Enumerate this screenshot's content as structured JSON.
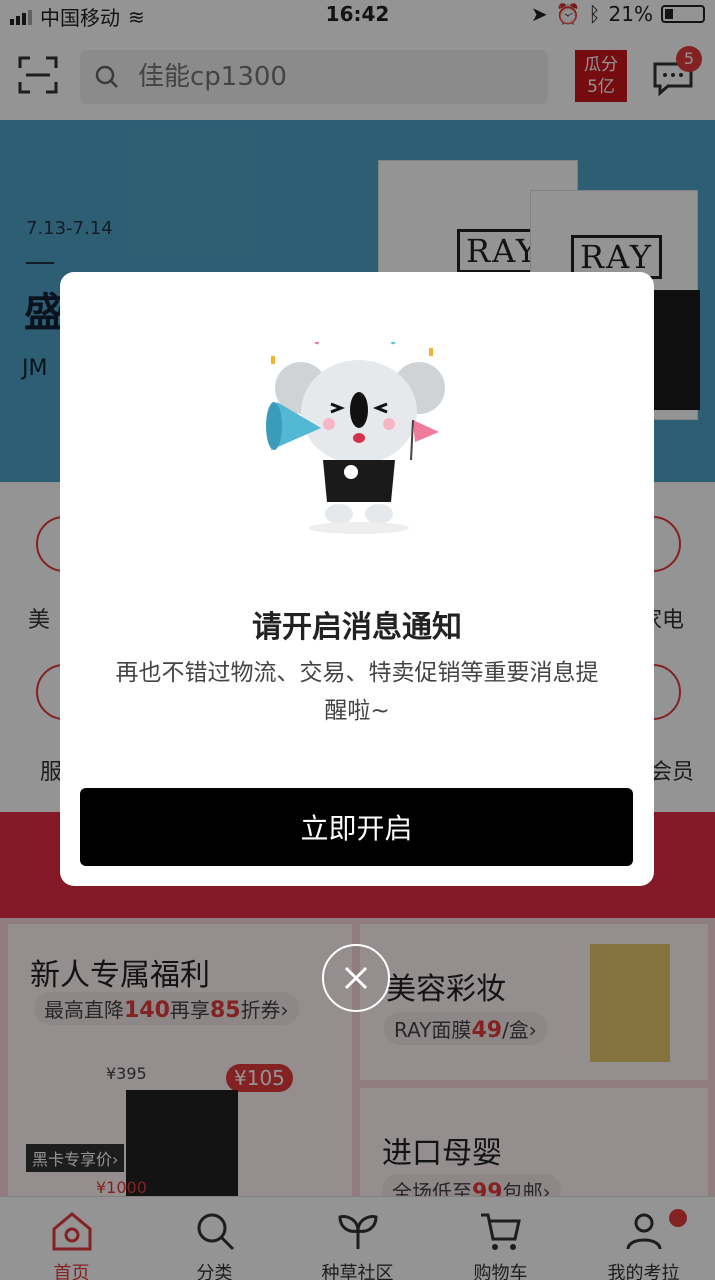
{
  "status_bar": {
    "carrier": "中国移动",
    "time": "16:42",
    "battery": "21%"
  },
  "header": {
    "search_placeholder": "佳能cp1300",
    "promo_badge_line1": "瓜分",
    "promo_badge_line2": "5亿",
    "message_count": "5"
  },
  "banner": {
    "date": "7.13-7.14",
    "title": "盛",
    "subtitle": "JM",
    "product_logo": "RAY"
  },
  "categories": [
    {
      "label": "美"
    },
    {
      "label": "家电"
    },
    {
      "label": "服"
    },
    {
      "label": "会员"
    }
  ],
  "cards": {
    "left": {
      "title": "新人专属福利",
      "sub_prefix": "最高直降",
      "sub_num1": "140",
      "sub_mid": "再享",
      "sub_num2": "85",
      "sub_suffix": "折券›",
      "price1": "¥395",
      "price2": "¥105",
      "black_card": "黑卡专享价›",
      "price3": "¥1000"
    },
    "right_top": {
      "title": "美容彩妆",
      "sub_prefix": "RAY面膜",
      "sub_num": "49",
      "sub_suffix": "/盒›"
    },
    "right_bottom": {
      "title": "进口母婴",
      "sub_prefix": "全场低至",
      "sub_num": "99",
      "sub_suffix": "包邮›"
    }
  },
  "tabbar": {
    "items": [
      {
        "label": "首页",
        "icon": "home-icon"
      },
      {
        "label": "分类",
        "icon": "search-icon"
      },
      {
        "label": "种草社区",
        "icon": "sprout-icon"
      },
      {
        "label": "购物车",
        "icon": "cart-icon"
      },
      {
        "label": "我的考拉",
        "icon": "profile-icon"
      }
    ]
  },
  "modal": {
    "title": "请开启消息通知",
    "description": "再也不错过物流、交易、特卖促销等重要消息提醒啦~",
    "button_label": "立即开启"
  },
  "colors": {
    "brand_red": "#e4393c",
    "overlay": "rgba(0,0,0,0.42)"
  }
}
